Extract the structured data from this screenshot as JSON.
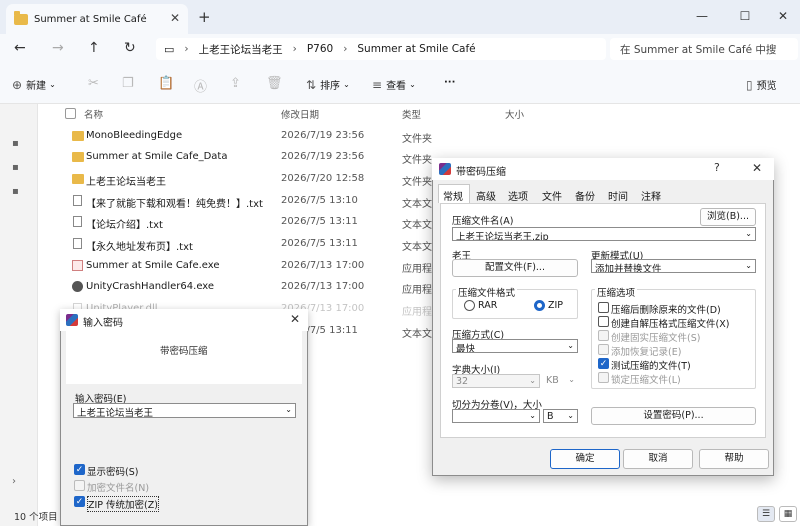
{
  "explorer": {
    "tab_title": "Summer at Smile Café",
    "new_tab": "+",
    "breadcrumb": [
      "上老王论坛当老王",
      "P760",
      "Summer at Smile Café"
    ],
    "search_placeholder": "在 Summer at Smile Café 中搜",
    "toolbar": {
      "new": "新建",
      "sort": "排序",
      "view": "查看",
      "more": "···",
      "preview": "预览"
    },
    "columns": {
      "name": "名称",
      "date": "修改日期",
      "type": "类型",
      "size": "大小"
    },
    "files": [
      {
        "name": "MonoBleedingEdge",
        "date": "2026/7/19 23:56",
        "type": "文件夹",
        "icon": "folder-icon"
      },
      {
        "name": "Summer at Smile Cafe_Data",
        "date": "2026/7/19 23:56",
        "type": "文件夹",
        "icon": "folder-icon"
      },
      {
        "name": "上老王论坛当老王",
        "date": "2026/7/20 12:58",
        "type": "文件夹",
        "icon": "folder-icon"
      },
      {
        "name": "【来了就能下载和观看！纯免费！】.txt",
        "date": "2026/7/5 13:10",
        "type": "文本文档",
        "icon": "text-file-icon"
      },
      {
        "name": "【论坛介绍】.txt",
        "date": "2026/7/5 13:11",
        "type": "文本文档",
        "icon": "text-file-icon"
      },
      {
        "name": "【永久地址发布页】.txt",
        "date": "2026/7/5 13:11",
        "type": "文本文档",
        "icon": "text-file-icon"
      },
      {
        "name": "Summer at Smile Cafe.exe",
        "date": "2026/7/13 17:00",
        "type": "应用程序",
        "icon": "exe-icon"
      },
      {
        "name": "UnityCrashHandler64.exe",
        "date": "2026/7/13 17:00",
        "type": "应用程序",
        "icon": "gear-exe-icon"
      },
      {
        "name": "UnityPlayer.dll",
        "date": "2026/7/13 17:00",
        "type": "应用程序扩展",
        "icon": "dll-icon"
      },
      {
        "name": "",
        "date": "2026/7/5 13:11",
        "type": "文本文档",
        "icon": "text-file-icon"
      }
    ],
    "status": "10 个项目"
  },
  "password_dialog": {
    "title": "输入密码",
    "header": "带密码压缩",
    "label": "输入密码(E)",
    "value": "上老王论坛当老王",
    "options": [
      {
        "label": "显示密码(S)",
        "checked": true,
        "disabled": false
      },
      {
        "label": "加密文件名(N)",
        "checked": false,
        "disabled": true
      },
      {
        "label": "ZIP 传统加密(Z)",
        "checked": true,
        "disabled": false
      }
    ]
  },
  "archive_dialog": {
    "title": "带密码压缩",
    "tabs": [
      "常规",
      "高级",
      "选项",
      "文件",
      "备份",
      "时间",
      "注释"
    ],
    "active_tab": "常规",
    "archive_name_label": "压缩文件名(A)",
    "browse_button": "浏览(B)...",
    "archive_name": "上老王论坛当老王.zip",
    "profile_label": "老王",
    "profile_button": "配置文件(F)...",
    "update_mode_label": "更新模式(U)",
    "update_mode": "添加并替换文件",
    "format_group": "压缩文件格式",
    "format_rar": "RAR",
    "format_zip": "ZIP",
    "format_selected": "ZIP",
    "options_group": "压缩选项",
    "options": [
      {
        "label": "压缩后删除原来的文件(D)",
        "checked": false,
        "disabled": false
      },
      {
        "label": "创建自解压格式压缩文件(X)",
        "checked": false,
        "disabled": false
      },
      {
        "label": "创建固实压缩文件(S)",
        "checked": false,
        "disabled": true
      },
      {
        "label": "添加恢复记录(E)",
        "checked": false,
        "disabled": true
      },
      {
        "label": "测试压缩的文件(T)",
        "checked": true,
        "disabled": false
      },
      {
        "label": "锁定压缩文件(L)",
        "checked": false,
        "disabled": true
      }
    ],
    "method_label": "压缩方式(C)",
    "method": "最快",
    "dict_label": "字典大小(I)",
    "dict_value": "32",
    "dict_unit": "KB",
    "split_label": "切分为分卷(V)，大小",
    "split_value": "",
    "split_unit": "B",
    "set_password_button": "设置密码(P)...",
    "ok": "确定",
    "cancel": "取消",
    "help": "帮助"
  }
}
